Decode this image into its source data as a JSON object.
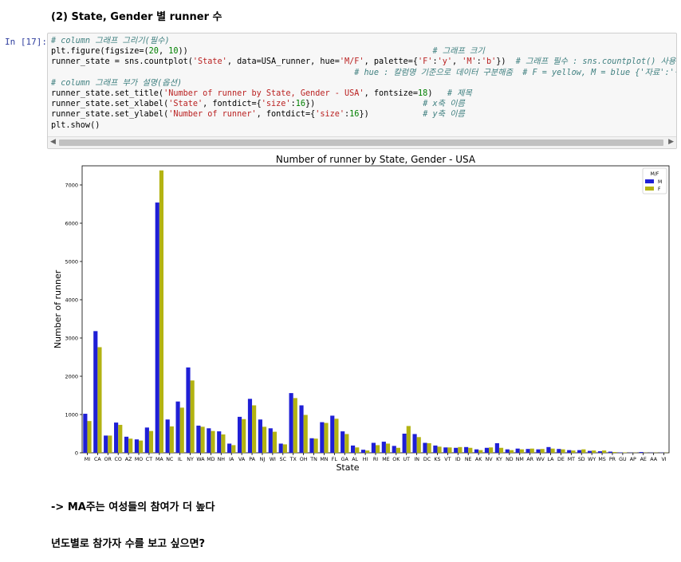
{
  "heading": "(2) State, Gender 별 runner 수",
  "cell": {
    "prompt": "In [17]:",
    "code_lines": [
      [
        [
          "cm",
          "# column 그래프 그리기(필수)"
        ]
      ],
      [
        [
          "tx",
          "plt.figure(figsize=("
        ],
        [
          "nu",
          "20"
        ],
        [
          "tx",
          ", "
        ],
        [
          "nu",
          "10"
        ],
        [
          "tx",
          "))                                                  "
        ],
        [
          "cm",
          "# 그래프 크기"
        ]
      ],
      [
        [
          "tx",
          "runner_state = sns.countplot("
        ],
        [
          "st",
          "'State'"
        ],
        [
          "tx",
          ", data=USA_runner, hue="
        ],
        [
          "st",
          "'M/F'"
        ],
        [
          "tx",
          ", palette={"
        ],
        [
          "st",
          "'F'"
        ],
        [
          "tx",
          ":"
        ],
        [
          "st",
          "'y'"
        ],
        [
          "tx",
          ", "
        ],
        [
          "st",
          "'M'"
        ],
        [
          "tx",
          ":"
        ],
        [
          "st",
          "'b'"
        ],
        [
          "tx",
          "})  "
        ],
        [
          "cm",
          "# 그래프 필수 : sns.countplot() 사용"
        ]
      ],
      [
        [
          "tx",
          "                                                              "
        ],
        [
          "cm",
          "# hue : 칼럼명 기준으로 데이터 구분해줌  # F = yellow, M = blue {'자료':'색'}"
        ]
      ],
      [
        [
          "cm",
          "# column 그래프 부가 설명(옵션)"
        ]
      ],
      [
        [
          "tx",
          "runner_state.set_title("
        ],
        [
          "st",
          "'Number of runner by State, Gender - USA'"
        ],
        [
          "tx",
          ", fontsize="
        ],
        [
          "nu",
          "18"
        ],
        [
          "tx",
          ")   "
        ],
        [
          "cm",
          "# 제목"
        ]
      ],
      [
        [
          "tx",
          "runner_state.set_xlabel("
        ],
        [
          "st",
          "'State'"
        ],
        [
          "tx",
          ", fontdict={"
        ],
        [
          "st",
          "'size'"
        ],
        [
          "tx",
          ":"
        ],
        [
          "nu",
          "16"
        ],
        [
          "tx",
          "})                      "
        ],
        [
          "cm",
          "# x축 이름"
        ]
      ],
      [
        [
          "tx",
          "runner_state.set_ylabel("
        ],
        [
          "st",
          "'Number of runner'"
        ],
        [
          "tx",
          ", fontdict={"
        ],
        [
          "st",
          "'size'"
        ],
        [
          "tx",
          ":"
        ],
        [
          "nu",
          "16"
        ],
        [
          "tx",
          "})           "
        ],
        [
          "cm",
          "# y축 이름"
        ]
      ],
      [
        [
          "tx",
          "plt.show()"
        ]
      ]
    ],
    "scroll_left": "◀",
    "scroll_right": "▶"
  },
  "chart_data": {
    "type": "bar",
    "title": "Number of runner by State, Gender - USA",
    "xlabel": "State",
    "ylabel": "Number of runner",
    "ylim": [
      0,
      7500
    ],
    "yticks": [
      0,
      1000,
      2000,
      3000,
      4000,
      5000,
      6000,
      7000
    ],
    "legend": {
      "title": "M/F",
      "position": "top-right"
    },
    "categories": [
      "MI",
      "CA",
      "OR",
      "CO",
      "AZ",
      "MO",
      "CT",
      "MA",
      "NC",
      "IL",
      "NY",
      "WA",
      "MD",
      "NH",
      "IA",
      "VA",
      "PA",
      "NJ",
      "WI",
      "SC",
      "TX",
      "OH",
      "TN",
      "MN",
      "FL",
      "GA",
      "AL",
      "HI",
      "RI",
      "ME",
      "OK",
      "UT",
      "IN",
      "DC",
      "KS",
      "VT",
      "ID",
      "NE",
      "AK",
      "NV",
      "KY",
      "ND",
      "NM",
      "AR",
      "WV",
      "LA",
      "DE",
      "MT",
      "SD",
      "WY",
      "MS",
      "PR",
      "GU",
      "AP",
      "AE",
      "AA",
      "VI"
    ],
    "series": [
      {
        "name": "M",
        "color": "#1f1fd6",
        "values": [
          1020,
          3180,
          450,
          790,
          420,
          350,
          660,
          6540,
          870,
          1340,
          2230,
          710,
          640,
          560,
          240,
          940,
          1410,
          870,
          640,
          240,
          1560,
          1240,
          380,
          800,
          970,
          560,
          190,
          80,
          260,
          290,
          180,
          500,
          490,
          260,
          190,
          140,
          130,
          150,
          90,
          130,
          250,
          90,
          110,
          100,
          90,
          150,
          100,
          70,
          70,
          50,
          40,
          30,
          10,
          5,
          20,
          5,
          5
        ]
      },
      {
        "name": "F",
        "color": "#b3b312",
        "values": [
          830,
          2760,
          450,
          730,
          370,
          320,
          570,
          7380,
          690,
          1180,
          1890,
          680,
          570,
          480,
          200,
          880,
          1240,
          680,
          550,
          220,
          1430,
          990,
          370,
          780,
          890,
          490,
          140,
          60,
          200,
          240,
          130,
          700,
          410,
          250,
          160,
          140,
          150,
          130,
          70,
          140,
          130,
          70,
          90,
          110,
          100,
          110,
          90,
          60,
          90,
          60,
          60,
          20,
          10,
          5,
          5,
          5,
          5
        ]
      }
    ]
  },
  "md_text1": "-> MA주는 여성들의 참여가 더 높다",
  "md_text2": "년도별로 참가자 수를 보고 싶으면?"
}
